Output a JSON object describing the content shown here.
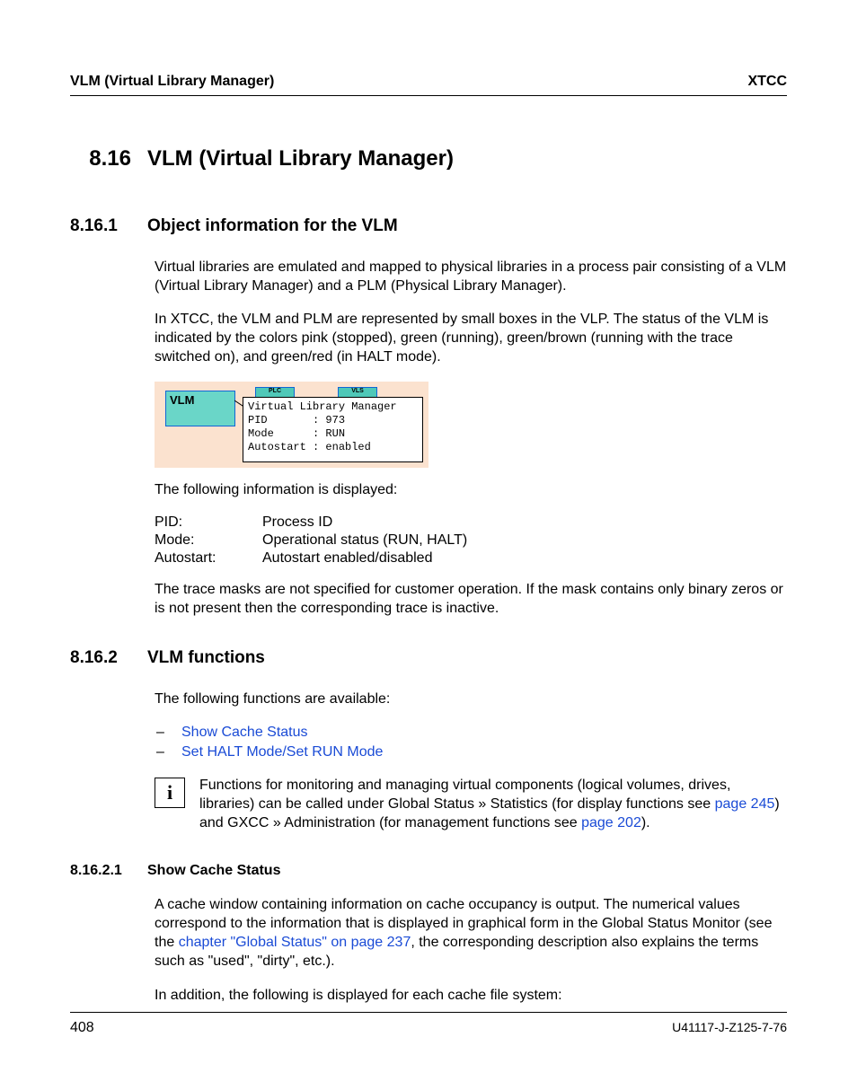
{
  "header": {
    "left": "VLM (Virtual Library Manager)",
    "right": "XTCC"
  },
  "h1": {
    "num": "8.16",
    "title": "VLM (Virtual Library Manager)"
  },
  "s1": {
    "num": "8.16.1",
    "title": "Object information for the VLM",
    "p1": "Virtual libraries are emulated and mapped to physical libraries in a process pair consisting of a VLM (Virtual Library Manager) and a PLM (Physical Library Manager).",
    "p2": "In XTCC, the VLM and PLM are represented by small boxes in the VLP. The status of the VLM is indicated by the colors pink (stopped), green (running), green/brown (running with the trace switched on), and green/red (in HALT mode).",
    "figure": {
      "vlm_label": "VLM",
      "box1": "PLC",
      "box2": "VLS",
      "tooltip": "Virtual Library Manager\nPID       : 973\nMode      : RUN\nAutostart : enabled"
    },
    "p3": "The following information is displayed:",
    "defs": [
      {
        "k": "PID:",
        "v": "Process ID"
      },
      {
        "k": "Mode:",
        "v": "Operational status (RUN, HALT)"
      },
      {
        "k": "Autostart:",
        "v": "Autostart enabled/disabled"
      }
    ],
    "p4": "The trace masks are not specified for customer operation. If the mask contains only binary zeros or is not present then the corresponding trace is inactive."
  },
  "s2": {
    "num": "8.16.2",
    "title": "VLM functions",
    "p1": "The following functions are available:",
    "links": [
      "Show Cache Status",
      "Set HALT Mode/Set RUN Mode"
    ],
    "info": {
      "icon": "i",
      "t1": "Functions for monitoring and managing virtual components (logical volumes, drives, libraries) can be called under Global Status » Statistics (for display functions see ",
      "l1": "page 245",
      "t2": ") and GXCC » Administration (for management functions see ",
      "l2": "page 202",
      "t3": ")."
    }
  },
  "s3": {
    "num": "8.16.2.1",
    "title": "Show Cache Status",
    "p1a": "A cache window containing information on cache occupancy is output. The numerical values correspond to the information that is displayed in graphical form in the Global Status Monitor (see the ",
    "p1link": "chapter \"Global Status\" on page 237",
    "p1b": ", the corresponding description also explains the terms such as \"used\", \"dirty\", etc.).",
    "p2": "In addition, the following is displayed for each cache file system:"
  },
  "footer": {
    "page": "408",
    "docid": "U41117-J-Z125-7-76"
  }
}
